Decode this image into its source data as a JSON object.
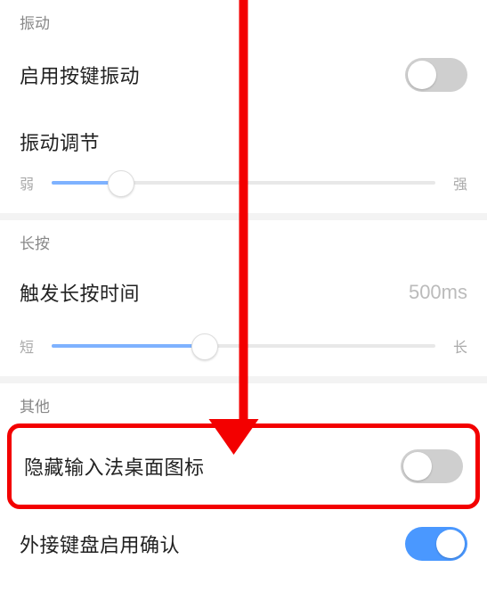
{
  "sections": {
    "vibration": {
      "header": "振动",
      "toggle_row": {
        "label": "启用按键振动",
        "state": "off"
      },
      "slider_row": {
        "label": "振动调节",
        "min_label": "弱",
        "max_label": "强",
        "value_percent": 18
      }
    },
    "longpress": {
      "header": "长按",
      "value_row": {
        "label": "触发长按时间",
        "value": "500ms"
      },
      "slider_row": {
        "min_label": "短",
        "max_label": "长",
        "value_percent": 40
      }
    },
    "other": {
      "header": "其他",
      "hide_icon_row": {
        "label": "隐藏输入法桌面图标",
        "state": "off"
      },
      "ext_kb_row": {
        "label": "外接键盘启用确认",
        "state": "on"
      }
    }
  },
  "annotation": {
    "arrow_color": "#f30000",
    "highlight_color": "#f30000"
  }
}
